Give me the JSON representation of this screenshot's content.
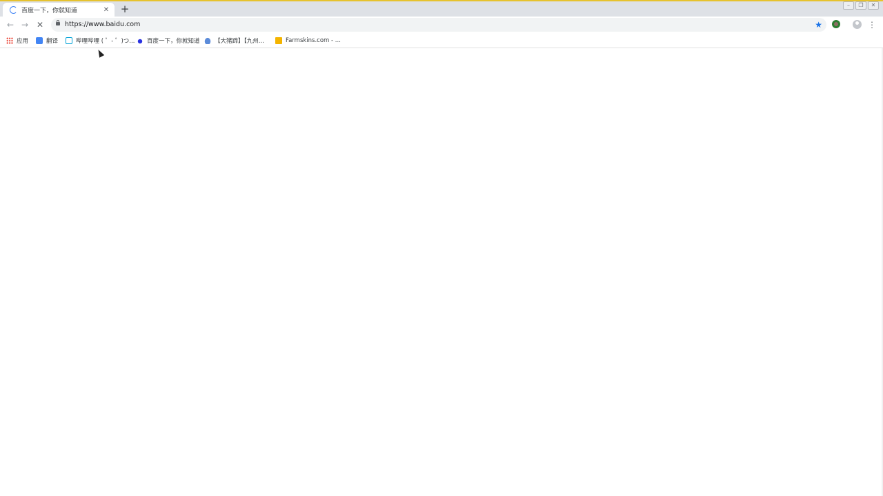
{
  "tab": {
    "title": "百度一下，你就知道",
    "close_glyph": "✕"
  },
  "new_tab_glyph": "+",
  "window_controls": {
    "minimize": "–",
    "restore": "❐",
    "close": "✕"
  },
  "toolbar": {
    "back_glyph": "←",
    "forward_glyph": "→",
    "stop_glyph": "✕",
    "url": "https://www.baidu.com",
    "star_glyph": "★",
    "menu_glyph": "⋮"
  },
  "bookmarks": [
    {
      "label": "应用",
      "icon": "apps-icon"
    },
    {
      "label": "翻译",
      "icon": "translate-icon"
    },
    {
      "label": "哔哩哔哩 ( ゜- ゜)つ...",
      "icon": "bilibili-icon"
    },
    {
      "label": "百度一下，你就知道",
      "icon": "baidu-icon"
    },
    {
      "label": "【大猪蹄】【九州...",
      "icon": "cloud-icon"
    },
    {
      "label": "Farmskins.com - ...",
      "icon": "farmskins-icon"
    }
  ],
  "colors": {
    "accent": "#e6c22e",
    "tabstrip": "#dee1e6",
    "omnibox": "#f1f3f4",
    "star": "#1a73e8"
  }
}
